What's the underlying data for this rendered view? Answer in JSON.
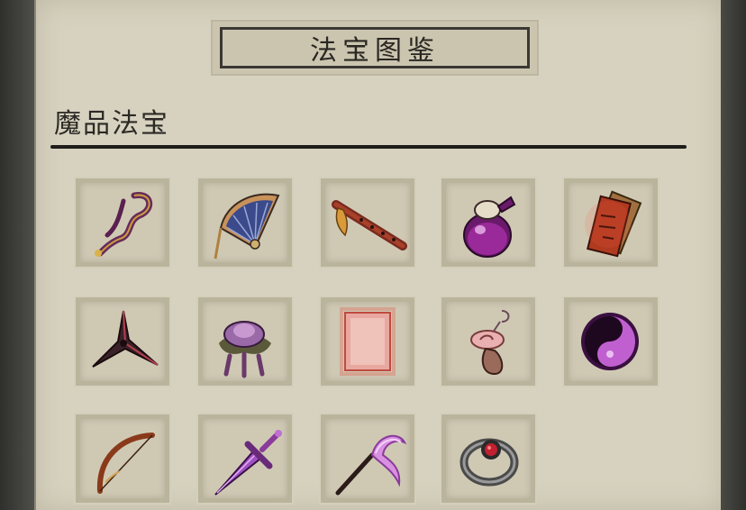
{
  "header": {
    "title": "法宝图鉴"
  },
  "section": {
    "label": "魔品法宝"
  },
  "items": [
    {
      "icon": "sash-icon"
    },
    {
      "icon": "fan-icon"
    },
    {
      "icon": "flute-icon"
    },
    {
      "icon": "gourd-potion-icon"
    },
    {
      "icon": "talisman-icon"
    },
    {
      "icon": "shuriken-icon"
    },
    {
      "icon": "lotus-icon"
    },
    {
      "icon": "blank-scroll-icon"
    },
    {
      "icon": "pendant-icon"
    },
    {
      "icon": "yin-yang-icon"
    },
    {
      "icon": "bow-icon"
    },
    {
      "icon": "sword-icon"
    },
    {
      "icon": "whisk-icon"
    },
    {
      "icon": "ring-icon"
    }
  ]
}
